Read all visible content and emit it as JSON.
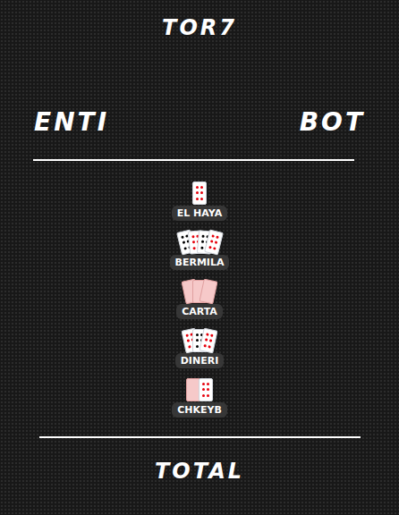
{
  "title": "TOR7",
  "players": [
    "ENTI",
    "BOT"
  ],
  "categories": [
    {
      "label": "EL HAYA",
      "kind": "single"
    },
    {
      "label": "BERMILA",
      "kind": "fan"
    },
    {
      "label": "CARTA",
      "kind": "backs"
    },
    {
      "label": "DINERI",
      "kind": "faces"
    },
    {
      "label": "CHKEYB",
      "kind": "pair"
    }
  ],
  "total": "TOTAL"
}
